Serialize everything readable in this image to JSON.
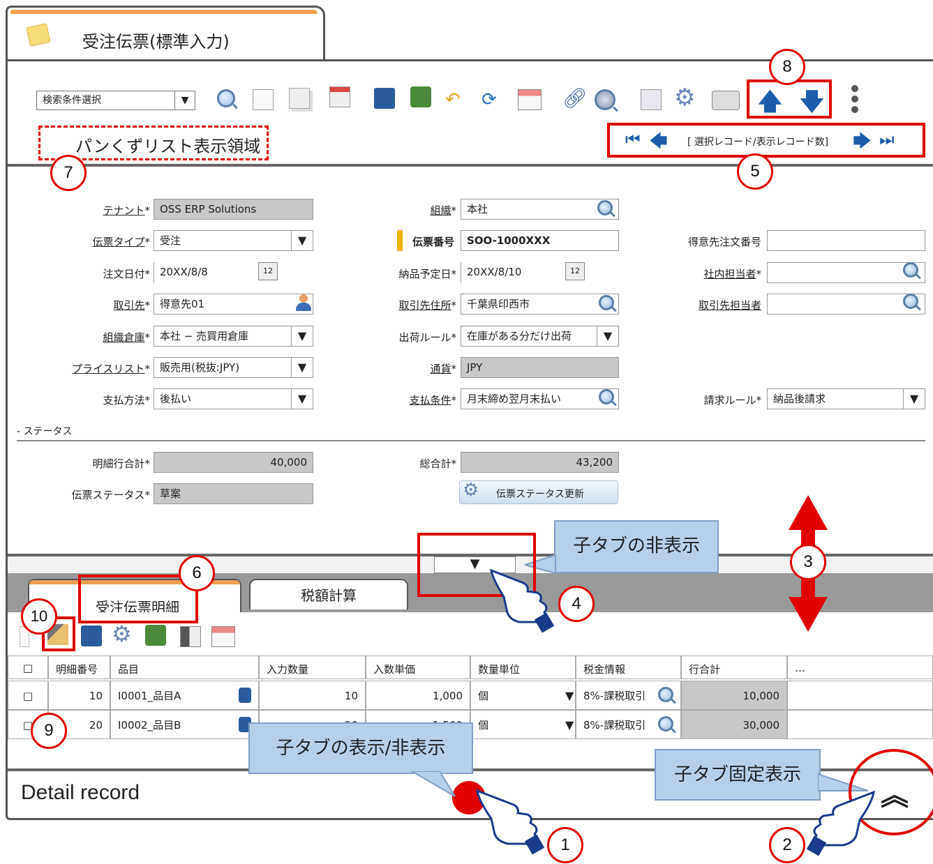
{
  "window": {
    "title": "受注伝票(標準入力)"
  },
  "toolbar": {
    "search_select": "検索条件選択",
    "breadcrumb_area": "パンくずリスト表示領域",
    "nav_record_text": "[ 選択レコード/表示レコード数]"
  },
  "fields": {
    "tenant_label": "テナント",
    "tenant_value": "OSS ERP Solutions",
    "org_label": "組織",
    "org_value": "本社",
    "doctype_label": "伝票タイプ",
    "doctype_value": "受注",
    "docno_label": "伝票番号",
    "docno_value": "SOO-1000XXX",
    "custorder_label": "得意先注文番号",
    "custorder_value": "",
    "orderdate_label": "注文日付",
    "orderdate_value": "20XX/8/8",
    "delivdate_label": "納品予定日",
    "delivdate_value": "20XX/8/10",
    "salesrep_label": "社内担当者",
    "salesrep_value": "",
    "bpartner_label": "取引先",
    "bpartner_value": "得意先01",
    "bpaddr_label": "取引先住所",
    "bpaddr_value": "千葉県印西市",
    "bpcontact_label": "取引先担当者",
    "bpcontact_value": "",
    "warehouse_label": "組織倉庫",
    "warehouse_value": "本社 − 売買用倉庫",
    "shiprule_label": "出荷ルール",
    "shiprule_value": "在庫がある分だけ出荷",
    "pricelist_label": "プライスリスト",
    "pricelist_value": "販売用(税抜:JPY)",
    "currency_label": "通貨",
    "currency_value": "JPY",
    "paymethod_label": "支払方法",
    "paymethod_value": "後払い",
    "payterm_label": "支払条件",
    "payterm_value": "月末締め翌月末払い",
    "invrule_label": "請求ルール",
    "invrule_value": "納品後請求",
    "status_section": "- ステータス",
    "linetotal_label": "明細行合計",
    "linetotal_value": "40,000",
    "grandtotal_label": "総合計",
    "grandtotal_value": "43,200",
    "docstatus_label": "伝票ステータス",
    "docstatus_value": "草案",
    "status_button": "伝票ステータス更新",
    "required_mark": "*"
  },
  "tabs": {
    "tab1": "受注伝票明細",
    "tab2": "税額計算"
  },
  "grid": {
    "headers": [
      "□",
      "明細番号",
      "品目",
      "入力数量",
      "入数単価",
      "数量単位",
      "税金情報",
      "行合計",
      "…"
    ],
    "rows": [
      {
        "check": "□",
        "lineno": "10",
        "item": "I0001_品目A",
        "qty": "10",
        "price": "1,000",
        "uom": "個",
        "tax": "8%-課税取引",
        "total": "10,000"
      },
      {
        "check": "□",
        "lineno": "20",
        "item": "I0002_品目B",
        "qty": "20",
        "price": "1,500",
        "uom": "個",
        "tax": "8%-課税取引",
        "total": "30,000"
      }
    ]
  },
  "footer": {
    "title": "Detail record",
    "pin_glyph": "︽"
  },
  "callouts": {
    "hide_child": "子タブの非表示",
    "toggle_child": "子タブの表示/非表示",
    "pin_child": "子タブ固定表示"
  },
  "markers": [
    "1",
    "2",
    "3",
    "4",
    "5",
    "6",
    "7",
    "8",
    "9",
    "10"
  ],
  "colors": {
    "accent_red": "#e00000",
    "callout_blue": "#b8cfe8",
    "tab_orange": "#f0a050"
  }
}
